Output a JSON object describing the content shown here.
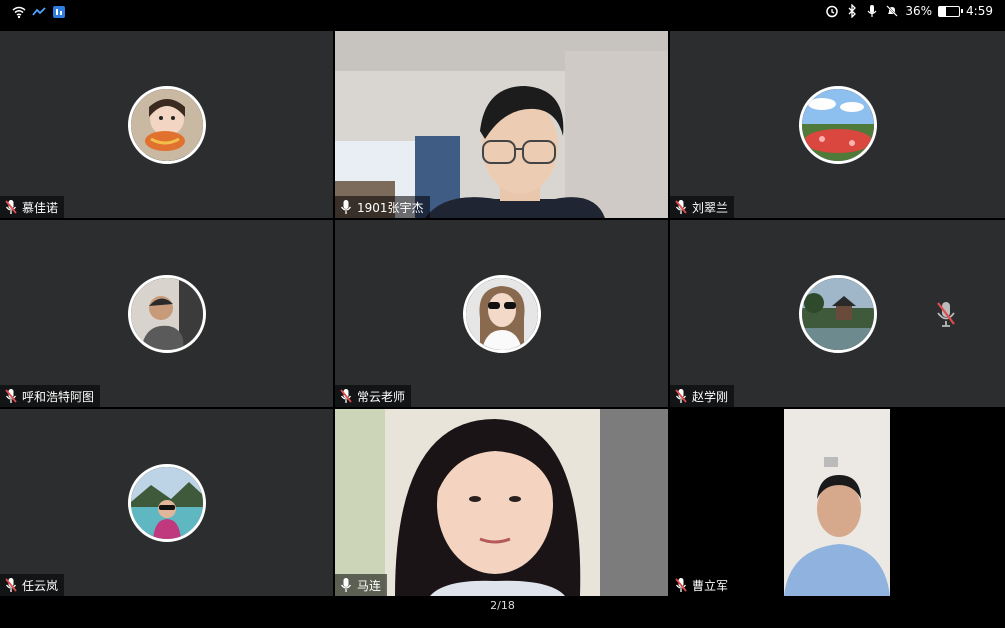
{
  "status_bar": {
    "battery_percent": "36%",
    "battery_level": 0.36,
    "time": "4:59",
    "icons_left": [
      "wifi-icon",
      "network-speed-icon",
      "app-icon"
    ],
    "icons_right": [
      "alarm-icon",
      "bluetooth-icon",
      "mic-icon",
      "mute-icon",
      "battery-icon"
    ]
  },
  "participants": [
    {
      "name": "慕佳诺",
      "type": "avatar",
      "mic_muted": true
    },
    {
      "name": "1901张宇杰",
      "type": "video",
      "mic_muted": false
    },
    {
      "name": "刘翠兰",
      "type": "avatar",
      "mic_muted": true
    },
    {
      "name": "呼和浩特阿图",
      "type": "avatar",
      "mic_muted": true
    },
    {
      "name": "常云老师",
      "type": "avatar",
      "mic_muted": true
    },
    {
      "name": "赵学刚",
      "type": "avatar",
      "mic_muted": true
    },
    {
      "name": "任云岚",
      "type": "avatar",
      "mic_muted": true
    },
    {
      "name": "马连",
      "type": "video",
      "mic_muted": false,
      "active_speaker": true
    },
    {
      "name": "曹立军",
      "type": "video",
      "mic_muted": true
    }
  ],
  "page_indicator": "2/18",
  "colors": {
    "tile_bg": "#2b2d2f",
    "active_border": "#2bb35a",
    "muted_mic": "#e24b4b"
  }
}
